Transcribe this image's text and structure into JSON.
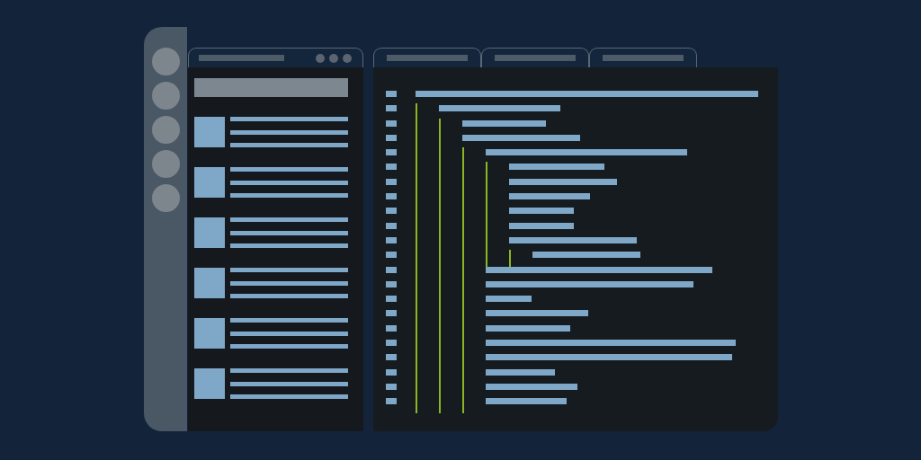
{
  "activity_bar": {
    "buttons": [
      {
        "kind": "circle"
      },
      {
        "kind": "circle"
      },
      {
        "kind": "circle"
      },
      {
        "kind": "circle"
      },
      {
        "kind": "circle"
      }
    ]
  },
  "explorer": {
    "header": {
      "kind": "title-bar",
      "dots": [
        {
          "kind": "dot"
        },
        {
          "kind": "dot"
        },
        {
          "kind": "dot"
        }
      ]
    },
    "search": {
      "kind": "bar"
    },
    "items": [
      {
        "kind": "thumbnail-row"
      },
      {
        "kind": "thumbnail-row"
      },
      {
        "kind": "thumbnail-row"
      },
      {
        "kind": "thumbnail-row"
      },
      {
        "kind": "thumbnail-row"
      },
      {
        "kind": "thumbnail-row"
      }
    ]
  },
  "editor": {
    "tabs": [
      {
        "kind": "tab"
      },
      {
        "kind": "tab"
      },
      {
        "kind": "tab"
      }
    ],
    "lines": [
      {
        "kind": "code-line",
        "children": [
          {
            "kind": "code-line",
            "children": [
              {
                "kind": "code-line"
              },
              {
                "kind": "code-line",
                "children": [
                  {
                    "kind": "code-line",
                    "children": [
                      {
                        "kind": "code-line"
                      },
                      {
                        "kind": "code-line"
                      },
                      {
                        "kind": "code-line"
                      },
                      {
                        "kind": "code-line"
                      },
                      {
                        "kind": "code-line"
                      },
                      {
                        "kind": "code-line",
                        "children": [
                          {
                            "kind": "code-line"
                          }
                        ]
                      }
                    ]
                  },
                  {
                    "kind": "code-line"
                  },
                  {
                    "kind": "code-line"
                  },
                  {
                    "kind": "code-line"
                  },
                  {
                    "kind": "code-line"
                  },
                  {
                    "kind": "code-line"
                  },
                  {
                    "kind": "code-line"
                  },
                  {
                    "kind": "code-line"
                  },
                  {
                    "kind": "code-line"
                  },
                  {
                    "kind": "code-line"
                  },
                  {
                    "kind": "code-line"
                  }
                ]
              }
            ]
          }
        ]
      }
    ]
  }
}
